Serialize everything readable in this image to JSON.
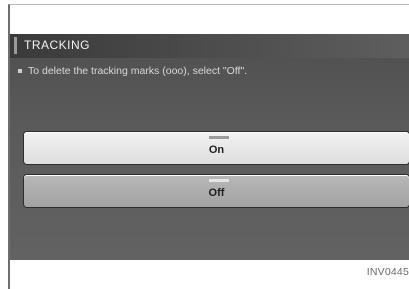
{
  "screen": {
    "title": "TRACKING",
    "instruction": "To delete the tracking marks (ooo), select \"Off\".",
    "options": [
      {
        "label": "On",
        "selected": false
      },
      {
        "label": "Off",
        "selected": true
      }
    ]
  },
  "figure_code": "INV0445"
}
